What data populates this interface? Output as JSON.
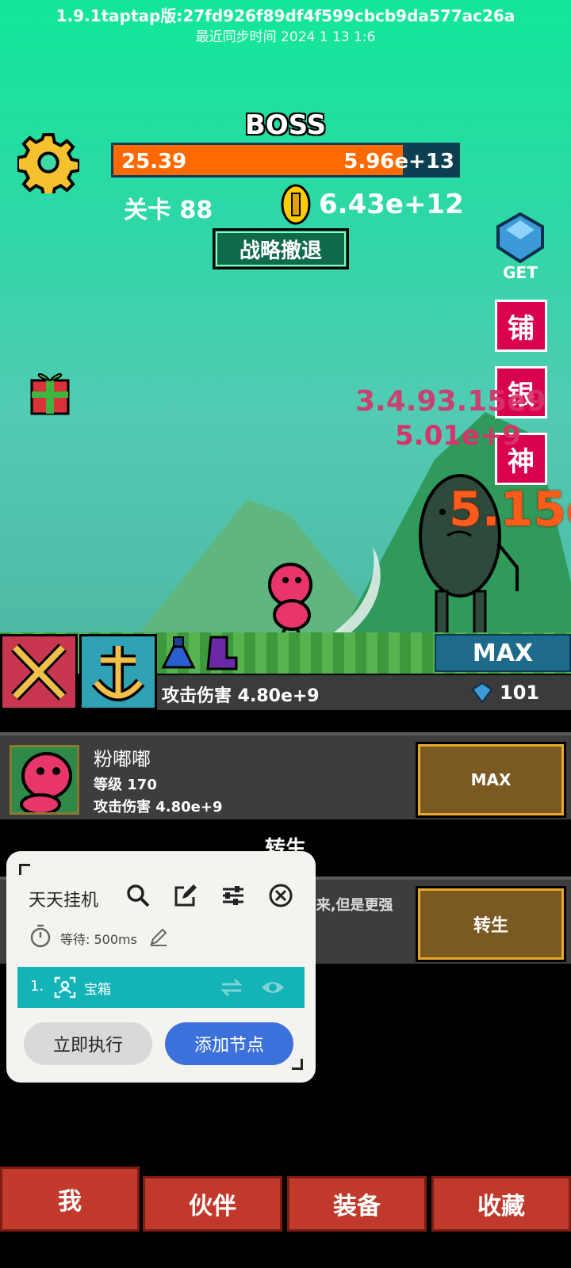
{
  "header": {
    "version": "1.9.1taptap版:27fd926f89df4f599cbcb9da577ac26a",
    "sync_time": "最近同步时间  2024  1  13  1:6"
  },
  "boss": {
    "label": "BOSS",
    "bar_left": "25.39",
    "bar_right": "5.96e+13",
    "hp_fraction": 0.84
  },
  "stage": {
    "label": "关卡 88"
  },
  "coins": {
    "value": "6.43e+12"
  },
  "retreat_button": "战略撤退",
  "gem_get": {
    "label": "GET"
  },
  "side_buttons": [
    "铺",
    "银",
    "神"
  ],
  "damage_numbers": {
    "overlap": "3.4.93.15e9",
    "middle": "5.01e+9",
    "big": "5.15e"
  },
  "skill_bar": {
    "max_label": "MAX",
    "attack_damage": "攻击伤害 4.80e+9",
    "gem_count": "101"
  },
  "hero": {
    "name": "粉嘟嘟",
    "level": "等级 170",
    "attack": "攻击伤害 4.80e+9",
    "max_button": "MAX"
  },
  "rebirth": {
    "title": "转生",
    "description": "转生...获得...精魄,回到最初,一切重来,但是更强",
    "button": "转生"
  },
  "macro_panel": {
    "title": "天天挂机",
    "wait_text": "等待: 500ms",
    "node_index": "1.",
    "node_label": "宝箱",
    "run_now": "立即执行",
    "add_node": "添加节点"
  },
  "tabs": [
    "我",
    "伙伴",
    "装备",
    "收藏"
  ],
  "colors": {
    "sky_top": "#12e79a",
    "boss_hp": "#ff6a00",
    "side_button": "#d8004f",
    "tab": "#c0392b",
    "brown_button": "#7a5a22",
    "macro_accent": "#3c71dc",
    "macro_row": "#14b3b8"
  },
  "icons": [
    "gear-icon",
    "coin-icon",
    "gem-icon",
    "gift-icon",
    "potion-icon",
    "boot-icon",
    "search-icon",
    "edit-icon",
    "filter-icon",
    "close-icon",
    "timer-icon",
    "pencil-icon",
    "image-icon",
    "swap-icon",
    "eye-icon"
  ]
}
